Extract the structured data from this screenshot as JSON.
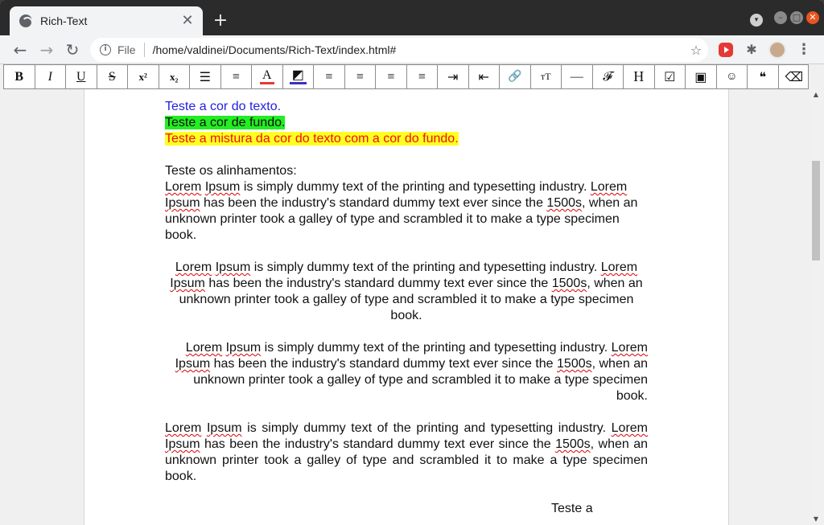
{
  "browser": {
    "tab_title": "Rich-Text",
    "tab_close": "✕",
    "new_tab": "+",
    "omnibox_scheme": "File",
    "url": "/home/valdinei/Documents/Rich-Text/index.html#",
    "back_glyph": "←",
    "forward_glyph": "→",
    "reload_glyph": "↻",
    "star_glyph": "☆",
    "puzzle_glyph": "✱",
    "menu_glyph": "⋮",
    "minimize_glyph": "–",
    "maximize_glyph": "□",
    "close_glyph": "✕",
    "profile_glyph": "▾",
    "info_glyph": "i"
  },
  "toolbar": {
    "buttons": [
      {
        "name": "bold",
        "glyph": "B",
        "icon": "bold-icon"
      },
      {
        "name": "italic",
        "glyph": "I",
        "icon": "italic-icon"
      },
      {
        "name": "underline",
        "glyph": "U",
        "icon": "underline-icon"
      },
      {
        "name": "strikethrough",
        "glyph": "S",
        "icon": "strikethrough-icon"
      },
      {
        "name": "superscript",
        "glyph": "x²",
        "icon": "superscript-icon"
      },
      {
        "name": "subscript",
        "glyph": "x₂",
        "icon": "subscript-icon"
      },
      {
        "name": "unordered-list",
        "glyph": "☰",
        "icon": "bulleted-list-icon"
      },
      {
        "name": "ordered-list",
        "glyph": "≡",
        "icon": "numbered-list-icon"
      },
      {
        "name": "text-color",
        "glyph": "A",
        "icon": "text-color-icon",
        "accent": "#e53935"
      },
      {
        "name": "background-color",
        "glyph": "◩",
        "icon": "highlight-icon",
        "accent": "#3f2ccc"
      },
      {
        "name": "align-left",
        "glyph": "≡",
        "icon": "align-left-icon"
      },
      {
        "name": "align-center",
        "glyph": "≡",
        "icon": "align-center-icon"
      },
      {
        "name": "align-right",
        "glyph": "≡",
        "icon": "align-right-icon"
      },
      {
        "name": "align-justify",
        "glyph": "≡",
        "icon": "align-justify-icon"
      },
      {
        "name": "indent",
        "glyph": "⇥",
        "icon": "indent-icon"
      },
      {
        "name": "outdent",
        "glyph": "⇤",
        "icon": "outdent-icon"
      },
      {
        "name": "link",
        "glyph": "🔗",
        "icon": "link-icon"
      },
      {
        "name": "font-size",
        "glyph": "ᴛT",
        "icon": "font-size-icon"
      },
      {
        "name": "horizontal-rule",
        "glyph": "—",
        "icon": "horizontal-rule-icon"
      },
      {
        "name": "font-family",
        "glyph": "𝓕",
        "icon": "font-family-icon"
      },
      {
        "name": "heading",
        "glyph": "H",
        "icon": "heading-icon"
      },
      {
        "name": "checkbox",
        "glyph": "☑",
        "icon": "checkbox-icon"
      },
      {
        "name": "image",
        "glyph": "▣",
        "icon": "image-icon"
      },
      {
        "name": "emoji",
        "glyph": "☺",
        "icon": "emoji-icon"
      },
      {
        "name": "blockquote",
        "glyph": "❝",
        "icon": "quote-icon"
      },
      {
        "name": "clear-format",
        "glyph": "⌫",
        "icon": "eraser-icon"
      }
    ]
  },
  "doc": {
    "line_blue": "Teste a cor do texto.",
    "line_bg": "Teste a cor de fundo.",
    "line_mix": "Teste a mistura da cor do texto com a cor do fundo.",
    "align_heading": "Teste os alinhamentos:",
    "lorem": {
      "w1": "Lorem",
      "w2": "Ipsum",
      "t1": " is simply dummy text of the printing and typesetting industry. ",
      "w3": "Lorem",
      "w4": "Ipsum",
      "t2": " has been the industry's standard dummy text ever since the ",
      "w5": "1500s",
      "t3": ", when an unknown printer took a galley of type and scrambled it to make a type specimen book."
    },
    "trailing_fragment_1": "Teste a",
    "trailing_fragment_2": "(cut off)"
  }
}
